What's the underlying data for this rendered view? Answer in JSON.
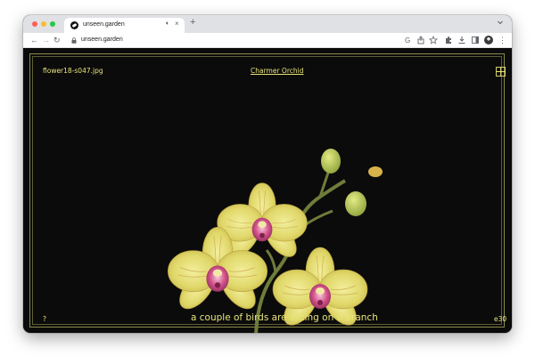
{
  "browser": {
    "tab_title": "unseen.garden",
    "tab_audio_icon": "speaker-icon",
    "tab_close": "×",
    "new_tab": "+",
    "url": "unseen.garden",
    "nav": {
      "back": "←",
      "forward": "→",
      "reload": "↻"
    },
    "menu": "⋮"
  },
  "page": {
    "filename": "flower18-s047.jpg",
    "title": "Charmer Orchid",
    "help": "?",
    "caption": "a couple of birds are sitting on a branch",
    "counter": "e30",
    "layout_icon": "grid-icon"
  },
  "colors": {
    "accent_text": "#e8e47a",
    "background": "#0b0b0b",
    "frame": "#8a8a4a"
  }
}
